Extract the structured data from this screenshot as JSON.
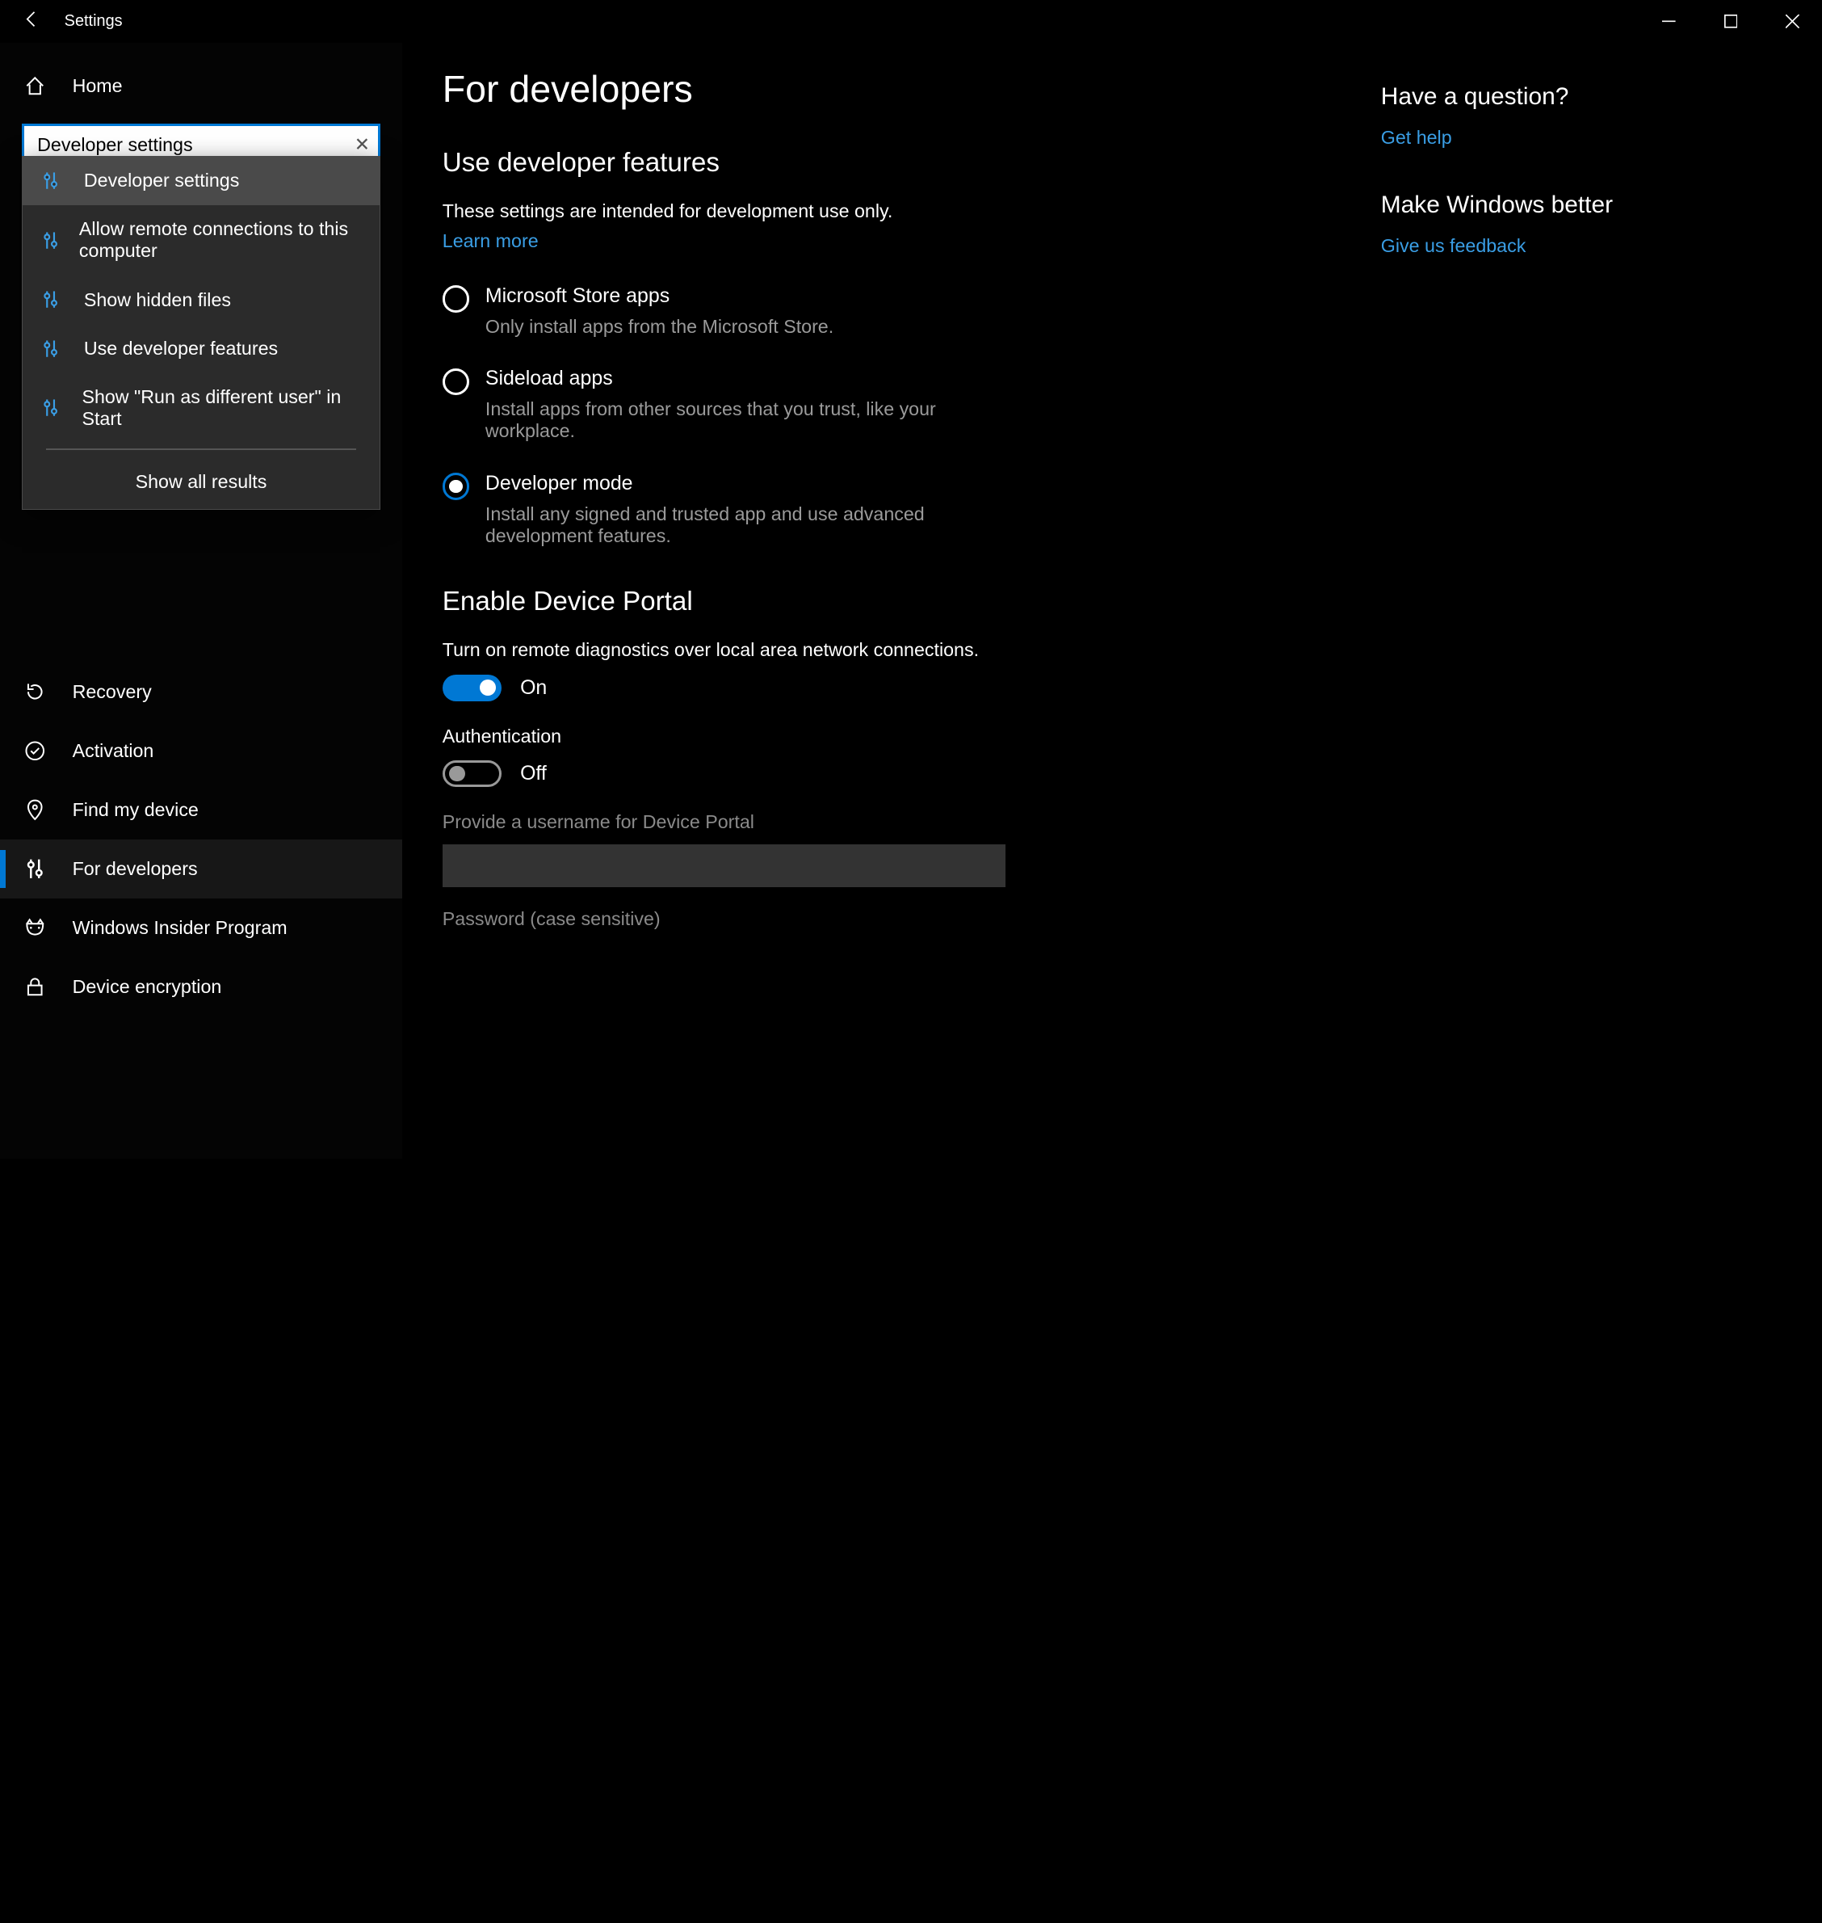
{
  "titlebar": {
    "title": "Settings"
  },
  "sidebar": {
    "home": "Home",
    "search_value": "Developer settings",
    "items": [
      {
        "label": "Recovery"
      },
      {
        "label": "Activation"
      },
      {
        "label": "Find my device"
      },
      {
        "label": "For developers"
      },
      {
        "label": "Windows Insider Program"
      },
      {
        "label": "Device encryption"
      }
    ]
  },
  "dropdown": {
    "items": [
      "Developer settings",
      "Allow remote connections to this computer",
      "Show hidden files",
      "Use developer features",
      "Show \"Run as different user\" in Start"
    ],
    "show_all": "Show all results"
  },
  "main": {
    "title": "For developers",
    "section1": {
      "heading": "Use developer features",
      "desc": "These settings are intended for development use only.",
      "learn_more": "Learn more",
      "radios": [
        {
          "label": "Microsoft Store apps",
          "sub": "Only install apps from the Microsoft Store."
        },
        {
          "label": "Sideload apps",
          "sub": "Install apps from other sources that you trust, like your workplace."
        },
        {
          "label": "Developer mode",
          "sub": "Install any signed and trusted app and use advanced development features."
        }
      ]
    },
    "section2": {
      "heading": "Enable Device Portal",
      "desc": "Turn on remote diagnostics over local area network connections.",
      "toggle1": "On",
      "auth_label": "Authentication",
      "toggle2": "Off",
      "username_label": "Provide a username for Device Portal",
      "password_label": "Password (case sensitive)"
    }
  },
  "aside": {
    "q_heading": "Have a question?",
    "q_link": "Get help",
    "fb_heading": "Make Windows better",
    "fb_link": "Give us feedback"
  }
}
